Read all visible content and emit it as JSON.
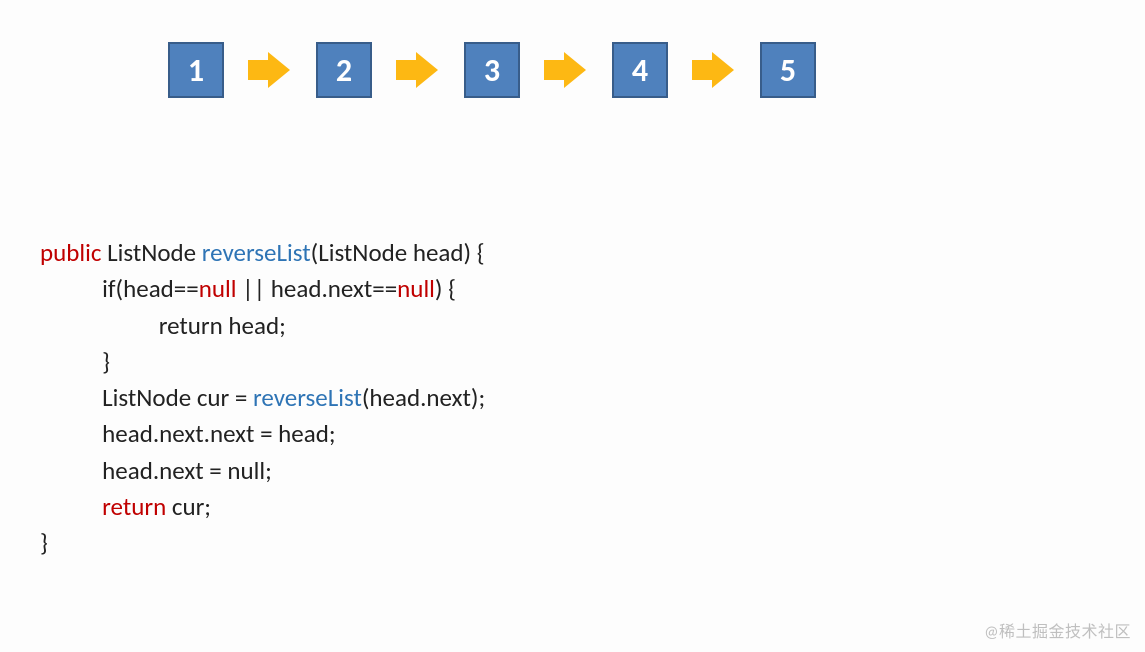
{
  "diagram": {
    "nodes": [
      "1",
      "2",
      "3",
      "4",
      "5"
    ]
  },
  "code": {
    "l1_public": "public",
    "l1_a": " ListNode ",
    "l1_reverseList": "reverseList",
    "l1_b": "(ListNode head) {",
    "l2_a": "           if(head==",
    "l2_null1": "null",
    "l2_b": " || head.next==",
    "l2_null2": "null",
    "l2_c": ") {",
    "l3": "                     return head;",
    "l4": "           }",
    "l5_a": "           ListNode cur = ",
    "l5_reverseList": "reverseList",
    "l5_b": "(head.next);",
    "l6": "           head.next.next = head;",
    "l7": "           head.next = null;",
    "l8_return": "           return",
    "l8_b": " cur;",
    "l9": "}"
  },
  "watermark": "@稀土掘金技术社区"
}
